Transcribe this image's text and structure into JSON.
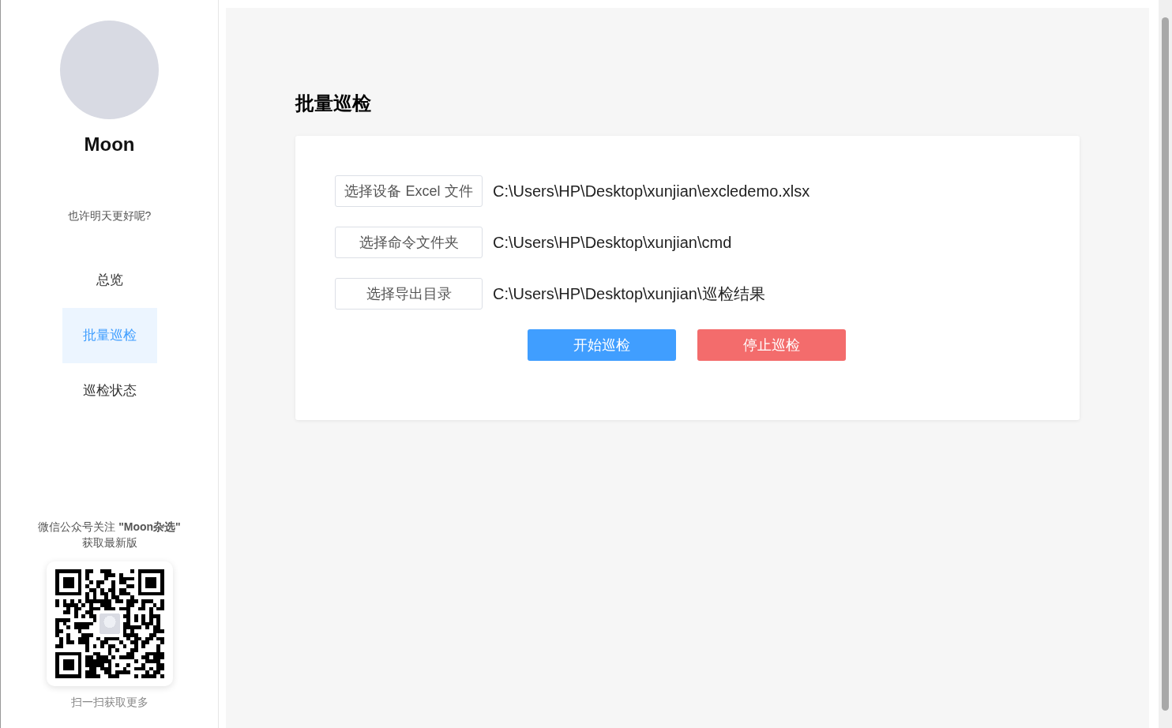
{
  "profile": {
    "name": "Moon",
    "motto": "也许明天更好呢?"
  },
  "nav": [
    {
      "label": "总览",
      "selected": false
    },
    {
      "label": "批量巡检",
      "selected": true
    },
    {
      "label": "巡检状态",
      "selected": false
    }
  ],
  "promo": {
    "text": "微信公众号关注 **\"Moon杂选\"**",
    "subtext": "获取最新版",
    "caption": "扫一扫获取更多"
  },
  "page": {
    "title": "批量巡检",
    "pickers": [
      {
        "button": "选择设备 Excel 文件",
        "path": "C:\\Users\\HP\\Desktop\\xunjian\\excledemo.xlsx"
      },
      {
        "button": "选择命令文件夹",
        "path": "C:\\Users\\HP\\Desktop\\xunjian\\cmd"
      },
      {
        "button": "选择导出目录",
        "path": "C:\\Users\\HP\\Desktop\\xunjian\\巡检结果"
      }
    ],
    "actions": [
      {
        "label": "开始巡检",
        "kind": "primary"
      },
      {
        "label": "停止巡检",
        "kind": "danger"
      }
    ]
  }
}
